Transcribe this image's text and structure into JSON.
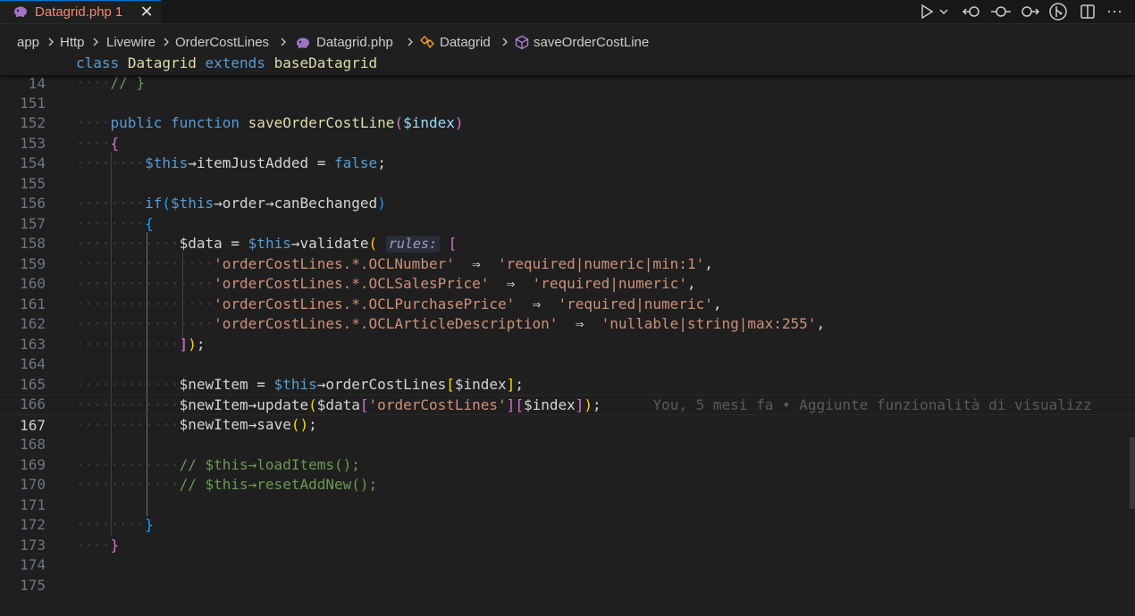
{
  "tab": {
    "filename": "Datagrid.php",
    "problem_count": "1",
    "close_glyph": "✕",
    "file_icon": "php-icon",
    "filename_color": "#f48771"
  },
  "toolbar": {
    "icons": [
      "run-icon",
      "chevron-down-icon",
      "go-back-icon",
      "timeline-icon",
      "go-forward-icon",
      "git-icon",
      "split-editor-icon",
      "more-icon"
    ],
    "more_glyph": "···"
  },
  "breadcrumb": {
    "items": [
      "app",
      "Http",
      "Livewire",
      "OrderCostLines",
      "Datagrid.php",
      "Datagrid",
      "saveOrderCostLine"
    ]
  },
  "editor": {
    "sticky_line": {
      "number": "14",
      "kw_class": "class",
      "name": "Datagrid",
      "kw_extends": "extends",
      "parent": "baseDatagrid"
    },
    "line_numbers": [
      "151",
      "152",
      "153",
      "154",
      "155",
      "156",
      "157",
      "158",
      "159",
      "160",
      "161",
      "162",
      "163",
      "164",
      "165",
      "166",
      "167",
      "168",
      "169",
      "170",
      "171",
      "172",
      "173",
      "174",
      "175"
    ],
    "active_line": "167",
    "tokens": {
      "l151_comment": "// }",
      "l153_public": "public",
      "l153_function": "function",
      "l153_name": "saveOrderCostLine",
      "l153_param": "$index",
      "l155_this": "$this",
      "l155_arrow": "→",
      "l155_prop": "itemJustAdded",
      "l155_eq": " = ",
      "l155_false": "false",
      "l155_semi": ";",
      "l157_if": "if",
      "l157_this": "$this",
      "l157_order": "order",
      "l157_can": "canBechanged",
      "l159_data": "$data",
      "l159_eq": " = ",
      "l159_this": "$this",
      "l159_validate": "validate",
      "l159_hint": "rules:",
      "l160_key": "'orderCostLines.*.OCLNumber'",
      "l160_val": "'required|numeric|min:1'",
      "l161_key": "'orderCostLines.*.OCLSalesPrice'",
      "l161_val": "'required|numeric'",
      "l162_key": "'orderCostLines.*.OCLPurchasePrice'",
      "l162_val": "'required|numeric'",
      "l163_key": "'orderCostLines.*.OCLArticleDescription'",
      "l163_val": "'nullable|string|max:255'",
      "fat_arrow": "⇒",
      "l166_newitem": "$newItem",
      "l166_this": "$this",
      "l166_prop": "orderCostLines",
      "l166_index": "$index",
      "l167_newitem": "$newItem",
      "l167_update": "update",
      "l167_data": "$data",
      "l167_key": "'orderCostLines'",
      "l167_index": "$index",
      "l167_blame": "You, 5 mesi fa • Aggiunte funzionalità di visualizz",
      "l168_newitem": "$newItem",
      "l168_save": "save",
      "l170_comment": "// $this→loadItems();",
      "l171_comment": "// $this→resetAddNew();"
    }
  }
}
